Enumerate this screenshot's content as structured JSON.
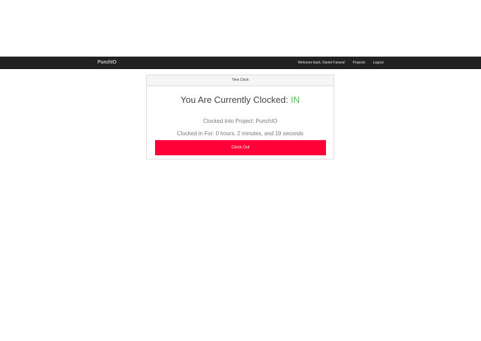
{
  "navbar": {
    "brand": "PunchIO",
    "welcome": "Welcome back, Daniel Fanara!",
    "links": [
      "Projects",
      "Logout"
    ],
    "background_color": "#222222"
  },
  "panel": {
    "heading": "Time Clock",
    "status_prefix": "You Are Currently Clocked:",
    "status_value": "IN",
    "status_color": "#5cb85c",
    "project_line": "Clocked Into Project: PunchIO",
    "duration_line": "Clocked in For: 0 hours, 2 minutes, and 19 seconds",
    "button_label": "Clock Out",
    "button_color": "#ff0038"
  }
}
